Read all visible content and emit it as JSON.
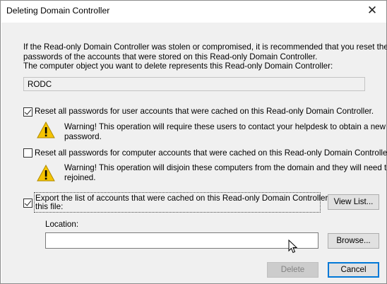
{
  "window": {
    "title": "Deleting Domain Controller"
  },
  "intro": {
    "line1": "If the Read-only Domain Controller was stolen or compromised, it is recommended that you reset the",
    "line2": "passwords of the accounts that were stored on this Read-only Domain Controller.",
    "line3": "The computer object you want to delete represents this Read-only Domain Controller:"
  },
  "computer_object": "RODC",
  "reset_users": {
    "checked": true,
    "label": "Reset all passwords for user accounts that were cached on this Read-only Domain Controller.",
    "warning_line1": "Warning! This operation will require these users to contact your helpdesk to obtain a new",
    "warning_line2": "password."
  },
  "reset_computers": {
    "checked": false,
    "label": "Reset all passwords for computer accounts that were cached on this Read-only Domain Controller.",
    "warning_line1": "Warning! This operation will disjoin these computers from the domain and they will need to be",
    "warning_line2": "rejoined."
  },
  "export": {
    "checked": true,
    "label_line1": "Export the list of accounts that were cached on this Read-only Domain Controller to",
    "label_line2": "this file:",
    "view_list_label": "View List...",
    "location_label": "Location:",
    "location_value": "",
    "browse_label": "Browse..."
  },
  "buttons": {
    "delete_label": "Delete",
    "cancel_label": "Cancel"
  },
  "icons": {
    "close": "close-icon",
    "warning": "warning-triangle-icon",
    "cursor": "mouse-pointer-icon"
  },
  "colors": {
    "body_bg": "#f0f0f0",
    "warning_yellow": "#f5c400",
    "default_button_border": "#0078d7"
  }
}
